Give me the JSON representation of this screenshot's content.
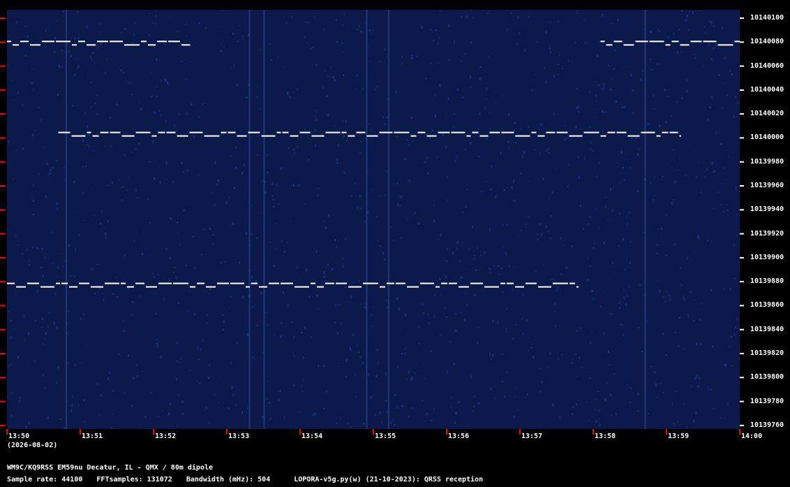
{
  "chart_data": {
    "type": "spectrogram",
    "date": "(2026-08-02)",
    "x_ticks": [
      "13:50",
      "13:51",
      "13:52",
      "13:53",
      "13:54",
      "13:55",
      "13:56",
      "13:57",
      "13:58",
      "13:59",
      "14:00"
    ],
    "y_ticks": [
      "10140100",
      "10140080",
      "10140060",
      "10140040",
      "10140020",
      "10140000",
      "10139980",
      "10139960",
      "10139940",
      "10139920",
      "10139900",
      "10139880",
      "10139860",
      "10139840",
      "10139820",
      "10139800",
      "10139780",
      "10139760"
    ],
    "ylim": [
      10139757,
      10140107
    ],
    "xlim": [
      "13:50",
      "14:00"
    ],
    "grid": false,
    "colors": {
      "background": "#0b1a4a",
      "signal": "#ffffff",
      "axis_marks": "#ff0000",
      "text": "#ffffff"
    },
    "series": [
      {
        "frequency": 10140080,
        "segments": [
          [
            "13:50.0",
            "13:52.5"
          ],
          [
            "13:58.1",
            "14:00"
          ]
        ]
      },
      {
        "frequency": 10140004,
        "segments": [
          [
            "13:50.7",
            "13:59.2"
          ]
        ]
      },
      {
        "frequency": 10139878,
        "segments": [
          [
            "13:50.0",
            "13:57.8"
          ]
        ]
      }
    ]
  },
  "footer": {
    "station": "WM9C/KQ9RSS EM59nu Decatur, IL - QMX / 80m dipole",
    "sample_rate": "Sample rate: 44100",
    "fft_samples": "FFTsamples: 131072",
    "bandwidth": "Bandwidth (mHz): 504",
    "software": "LOPORA-v5g.py(w) (21-10-2023): QRSS reception"
  }
}
